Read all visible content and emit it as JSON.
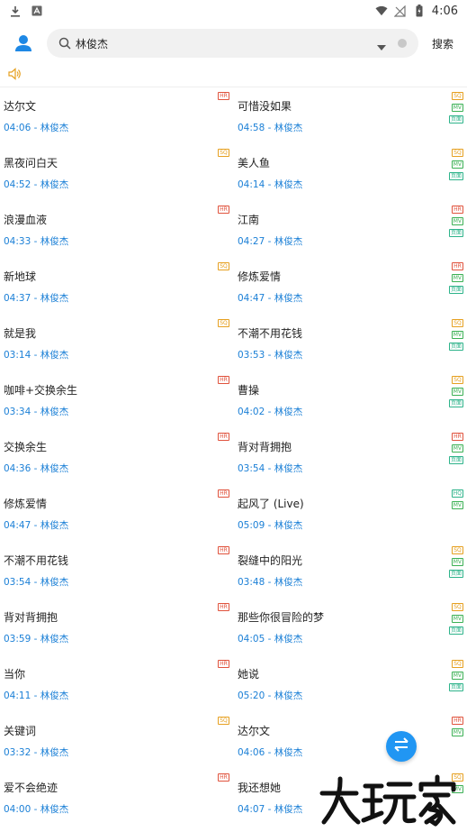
{
  "status_bar": {
    "time": "4:06",
    "left_icons": [
      "download-icon",
      "app-notification-icon"
    ],
    "right_icons": [
      "wifi-icon",
      "no-signal-icon",
      "battery-icon"
    ]
  },
  "search": {
    "query": "林俊杰",
    "button_label": "搜索"
  },
  "songs": [
    {
      "title": "达尔文",
      "time": "04:06",
      "artist": "林俊杰",
      "badges": [
        "HR"
      ]
    },
    {
      "title": "可惜没如果",
      "time": "04:58",
      "artist": "林俊杰",
      "badges": [
        "SQ",
        "MV",
        "页面"
      ]
    },
    {
      "title": "黑夜问白天",
      "time": "04:52",
      "artist": "林俊杰",
      "badges": [
        "SQ"
      ]
    },
    {
      "title": "美人鱼",
      "time": "04:14",
      "artist": "林俊杰",
      "badges": [
        "SQ",
        "MV",
        "页面"
      ]
    },
    {
      "title": "浪漫血液",
      "time": "04:33",
      "artist": "林俊杰",
      "badges": [
        "HR"
      ]
    },
    {
      "title": "江南",
      "time": "04:27",
      "artist": "林俊杰",
      "badges": [
        "HR",
        "MV",
        "页面"
      ]
    },
    {
      "title": "新地球",
      "time": "04:37",
      "artist": "林俊杰",
      "badges": [
        "SQ"
      ]
    },
    {
      "title": "修炼爱情",
      "time": "04:47",
      "artist": "林俊杰",
      "badges": [
        "HR",
        "MV",
        "页面"
      ]
    },
    {
      "title": "就是我",
      "time": "03:14",
      "artist": "林俊杰",
      "badges": [
        "SQ"
      ]
    },
    {
      "title": "不潮不用花钱",
      "time": "03:53",
      "artist": "林俊杰",
      "badges": [
        "SQ",
        "MV",
        "页面"
      ]
    },
    {
      "title": "咖啡+交换余生",
      "time": "03:34",
      "artist": "林俊杰",
      "badges": [
        "HR"
      ]
    },
    {
      "title": "曹操",
      "time": "04:02",
      "artist": "林俊杰",
      "badges": [
        "SQ",
        "MV",
        "页面"
      ]
    },
    {
      "title": "交换余生",
      "time": "04:36",
      "artist": "林俊杰",
      "badges": [
        "HR"
      ]
    },
    {
      "title": "背对背拥抱",
      "time": "03:54",
      "artist": "林俊杰",
      "badges": [
        "HR",
        "MV",
        "页面"
      ]
    },
    {
      "title": "修炼爱情",
      "time": "04:47",
      "artist": "林俊杰",
      "badges": [
        "HR"
      ]
    },
    {
      "title": "起风了 (Live)",
      "time": "05:09",
      "artist": "林俊杰",
      "badges": [
        "HQ",
        "MV"
      ]
    },
    {
      "title": "不潮不用花钱",
      "time": "03:54",
      "artist": "林俊杰",
      "badges": [
        "HR"
      ]
    },
    {
      "title": "裂缝中的阳光",
      "time": "03:48",
      "artist": "林俊杰",
      "badges": [
        "SQ",
        "MV",
        "页面"
      ]
    },
    {
      "title": "背对背拥抱",
      "time": "03:59",
      "artist": "林俊杰",
      "badges": [
        "HR"
      ]
    },
    {
      "title": "那些你很冒险的梦",
      "time": "04:05",
      "artist": "林俊杰",
      "badges": [
        "SQ",
        "MV",
        "页面"
      ]
    },
    {
      "title": "当你",
      "time": "04:11",
      "artist": "林俊杰",
      "badges": [
        "HR"
      ]
    },
    {
      "title": "她说",
      "time": "05:20",
      "artist": "林俊杰",
      "badges": [
        "SQ",
        "MV",
        "页面"
      ]
    },
    {
      "title": "关键词",
      "time": "03:32",
      "artist": "林俊杰",
      "badges": [
        "SQ"
      ]
    },
    {
      "title": "达尔文",
      "time": "04:06",
      "artist": "林俊杰",
      "badges": [
        "HR",
        "MV"
      ]
    },
    {
      "title": "爱不会绝迹",
      "time": "04:00",
      "artist": "林俊杰",
      "badges": [
        "HR"
      ]
    },
    {
      "title": "我还想她",
      "time": "04:07",
      "artist": "林俊杰",
      "badges": [
        "SQ",
        "MV"
      ]
    }
  ],
  "meta_separator": " - ",
  "watermark": "大玩家",
  "colors": {
    "accent": "#2196f3",
    "meta_text": "#1a7fd6",
    "badge_hr": "#e0533d",
    "badge_sq": "#e6a020",
    "badge_mv": "#3bb054"
  }
}
